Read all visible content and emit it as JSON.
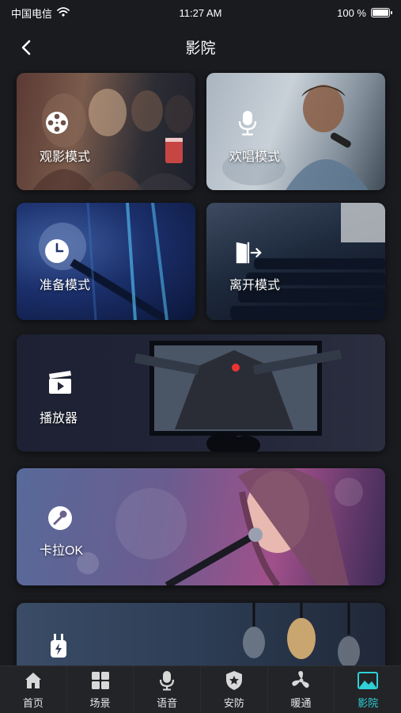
{
  "status_bar": {
    "carrier": "中国电信",
    "time": "11:27 AM",
    "battery": "100 %",
    "battery_level": 1.0
  },
  "header": {
    "title": "影院"
  },
  "cards": [
    {
      "label": "观影模式",
      "icon": "film-reel-icon"
    },
    {
      "label": "欢唱模式",
      "icon": "microphone-icon"
    },
    {
      "label": "准备模式",
      "icon": "clock-icon"
    },
    {
      "label": "离开模式",
      "icon": "exit-door-icon"
    },
    {
      "label": "播放器",
      "icon": "play-clapper-icon"
    },
    {
      "label": "卡拉OK",
      "icon": "karaoke-mic-icon"
    },
    {
      "label": "",
      "icon": "power-plug-icon"
    }
  ],
  "tabs": [
    {
      "label": "首页",
      "icon": "home-icon",
      "active": false
    },
    {
      "label": "场景",
      "icon": "grid-icon",
      "active": false
    },
    {
      "label": "语音",
      "icon": "voice-mic-icon",
      "active": false
    },
    {
      "label": "安防",
      "icon": "shield-icon",
      "active": false
    },
    {
      "label": "暖通",
      "icon": "fan-icon",
      "active": false
    },
    {
      "label": "影院",
      "icon": "cinema-icon",
      "active": true
    }
  ],
  "colors": {
    "accent": "#2fd0d6",
    "background": "#1a1b1f",
    "tab_bar": "#232428"
  }
}
